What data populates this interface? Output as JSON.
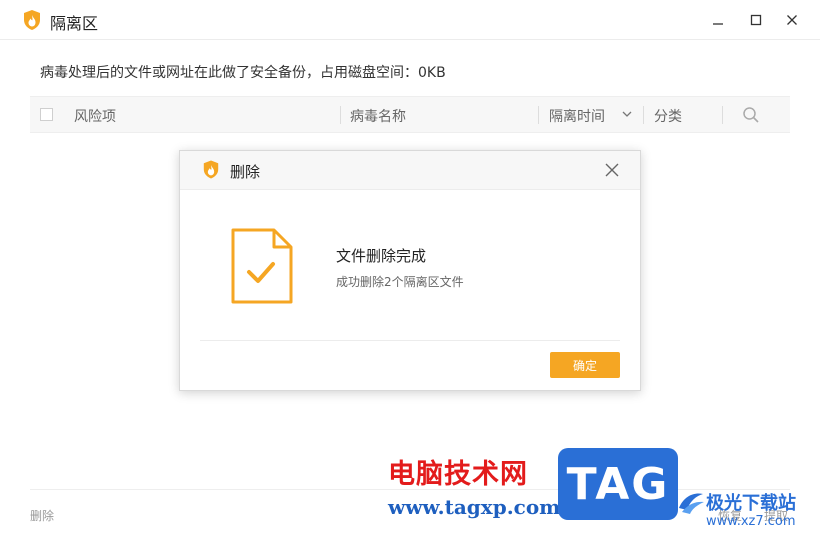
{
  "window": {
    "title": "隔离区",
    "icons": {
      "logo": "shield-fire-icon",
      "minimize": "minimize-icon",
      "maximize": "maximize-icon",
      "close": "close-icon"
    }
  },
  "main": {
    "info": "病毒处理后的文件或网址在此做了安全备份，占用磁盘空间：0KB"
  },
  "table": {
    "columns": [
      "风险项",
      "病毒名称",
      "隔离时间",
      "分类"
    ],
    "icons": {
      "sort": "chevron-down-icon",
      "search": "search-icon"
    }
  },
  "footer": {
    "delete": "删除",
    "restore": "恢复",
    "submit": "提取"
  },
  "dialog": {
    "title": "删除",
    "message": "文件删除完成",
    "sub": "成功删除2个隔离区文件",
    "ok": "确定",
    "icons": {
      "logo": "shield-fire-icon",
      "close": "close-icon",
      "doc": "document-check-icon"
    }
  },
  "watermark": {
    "site_name": "电脑技术网",
    "site_url": "www.tagxp.com",
    "badge": "TAG",
    "brand": "极光下载站",
    "brand_url": "www.xz7.com"
  },
  "colors": {
    "accent": "#f5a623",
    "watermark_red": "#e31b1b",
    "watermark_blue": "#2a6fd6"
  }
}
